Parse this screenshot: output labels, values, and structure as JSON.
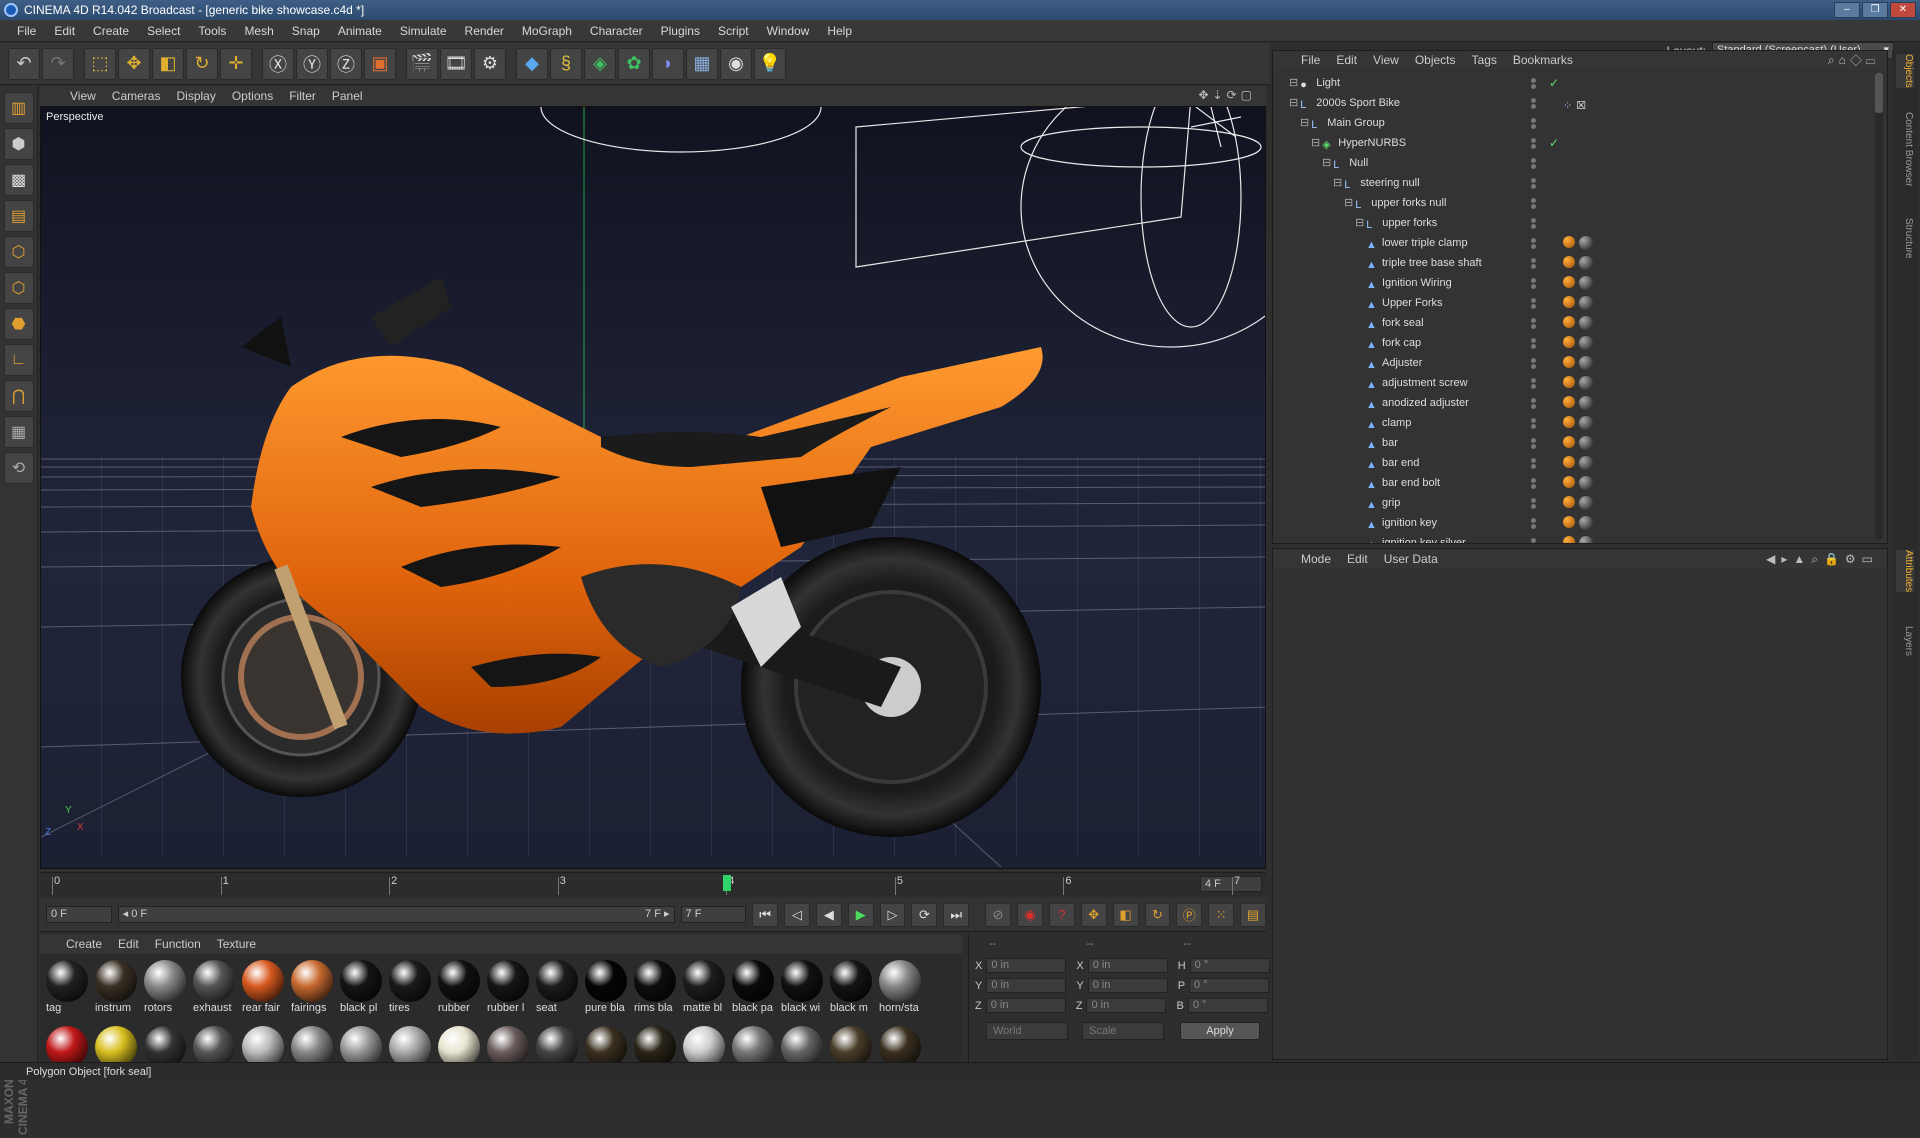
{
  "window": {
    "title": "CINEMA 4D R14.042 Broadcast - [generic bike showcase.c4d *]"
  },
  "menubar": [
    "File",
    "Edit",
    "Create",
    "Select",
    "Tools",
    "Mesh",
    "Snap",
    "Animate",
    "Simulate",
    "Render",
    "MoGraph",
    "Character",
    "Plugins",
    "Script",
    "Window",
    "Help"
  ],
  "layout": {
    "label": "Layout:",
    "value": "Standard (Screencast) (User)"
  },
  "viewport": {
    "menu": [
      "View",
      "Cameras",
      "Display",
      "Options",
      "Filter",
      "Panel"
    ],
    "label": "Perspective",
    "axis_y": "Y",
    "axis_x": "X",
    "axis_z": "Z"
  },
  "timeline": {
    "ticks": [
      "0",
      "1",
      "2",
      "3",
      "4",
      "5",
      "6",
      "7"
    ],
    "current_frame": 4,
    "frame_field": "4 F"
  },
  "transport": {
    "start": "0 F",
    "range_start": "◂ 0 F",
    "range_end": "7 F ▸",
    "end": "7 F"
  },
  "material_menu": [
    "Create",
    "Edit",
    "Function",
    "Texture"
  ],
  "materials_row1": [
    {
      "label": "tag",
      "color": "#222"
    },
    {
      "label": "instrum",
      "color": "#3a3024"
    },
    {
      "label": "rotors",
      "color": "#8a8a8a"
    },
    {
      "label": "exhaust",
      "color": "#555"
    },
    {
      "label": "rear fair",
      "color": "#d85a20"
    },
    {
      "label": "fairings",
      "color": "#c86a30"
    },
    {
      "label": "black pl",
      "color": "#151515"
    },
    {
      "label": "tires",
      "color": "#1a1a1a"
    },
    {
      "label": "rubber",
      "color": "#111"
    },
    {
      "label": "rubber l",
      "color": "#161616"
    },
    {
      "label": "seat",
      "color": "#1c1c1c"
    },
    {
      "label": "pure bla",
      "color": "#050505"
    },
    {
      "label": "rims bla",
      "color": "#0d0d0d"
    },
    {
      "label": "matte bl",
      "color": "#1e1e1e"
    },
    {
      "label": "black pa",
      "color": "#0a0a0a"
    },
    {
      "label": "black wi",
      "color": "#111"
    },
    {
      "label": "black m",
      "color": "#141414"
    },
    {
      "label": "horn/sta",
      "color": "#888"
    }
  ],
  "materials_row2": [
    "#c01818",
    "#d8c020",
    "#333",
    "#555",
    "#bbb",
    "#888",
    "#999",
    "#aaa",
    "#e8e4d0",
    "#6a5c5c",
    "#444",
    "#3a3020",
    "#2a2418",
    "#ccc",
    "#777",
    "#666",
    "#4a3e2a",
    "#3a3020"
  ],
  "coords": {
    "headers": [
      "--",
      "--",
      "--"
    ],
    "rows": [
      {
        "a": "X",
        "av": "0 in",
        "b": "X",
        "bv": "0 in",
        "c": "H",
        "cv": "0 °"
      },
      {
        "a": "Y",
        "av": "0 in",
        "b": "Y",
        "bv": "0 in",
        "c": "P",
        "cv": "0 °"
      },
      {
        "a": "Z",
        "av": "0 in",
        "b": "Z",
        "bv": "0 in",
        "c": "B",
        "cv": "0 °"
      }
    ],
    "world": "World",
    "scale": "Scale",
    "apply": "Apply"
  },
  "object_menu": [
    "File",
    "Edit",
    "View",
    "Objects",
    "Tags",
    "Bookmarks"
  ],
  "objects": [
    {
      "name": "Light",
      "indent": 0,
      "icon": "light-icon",
      "check": true,
      "tags": 0
    },
    {
      "name": "2000s Sport Bike",
      "indent": 0,
      "icon": "null-icon",
      "check": false,
      "tags": -1
    },
    {
      "name": "Main Group",
      "indent": 1,
      "icon": "null-icon",
      "check": false,
      "tags": 0
    },
    {
      "name": "HyperNURBS",
      "indent": 2,
      "icon": "hypernurbs-icon",
      "check": true,
      "tags": 0
    },
    {
      "name": "Null",
      "indent": 3,
      "icon": "null-icon",
      "check": false,
      "tags": 0
    },
    {
      "name": "steering null",
      "indent": 4,
      "icon": "null-icon",
      "check": false,
      "tags": 0
    },
    {
      "name": "upper forks null",
      "indent": 5,
      "icon": "null-icon",
      "check": false,
      "tags": 0
    },
    {
      "name": "upper forks",
      "indent": 6,
      "icon": "null-icon",
      "check": false,
      "tags": 0
    },
    {
      "name": "lower triple clamp",
      "indent": 7,
      "icon": "polygon-icon",
      "check": false,
      "tags": 2
    },
    {
      "name": "triple tree base shaft",
      "indent": 7,
      "icon": "polygon-icon",
      "check": false,
      "tags": 2
    },
    {
      "name": "Ignition Wiring",
      "indent": 7,
      "icon": "polygon-icon",
      "check": false,
      "tags": 2
    },
    {
      "name": "Upper Forks",
      "indent": 7,
      "icon": "polygon-icon",
      "check": false,
      "tags": 2
    },
    {
      "name": "fork seal",
      "indent": 7,
      "icon": "polygon-icon",
      "check": false,
      "tags": 2
    },
    {
      "name": "fork cap",
      "indent": 7,
      "icon": "polygon-icon",
      "check": false,
      "tags": 2
    },
    {
      "name": "Adjuster",
      "indent": 7,
      "icon": "polygon-icon",
      "check": false,
      "tags": 2
    },
    {
      "name": "adjustment screw",
      "indent": 7,
      "icon": "polygon-icon",
      "check": false,
      "tags": 2
    },
    {
      "name": "anodized adjuster",
      "indent": 7,
      "icon": "polygon-icon",
      "check": false,
      "tags": 2
    },
    {
      "name": "clamp",
      "indent": 7,
      "icon": "polygon-icon",
      "check": false,
      "tags": 2
    },
    {
      "name": "bar",
      "indent": 7,
      "icon": "polygon-icon",
      "check": false,
      "tags": 2
    },
    {
      "name": "bar end",
      "indent": 7,
      "icon": "polygon-icon",
      "check": false,
      "tags": 2
    },
    {
      "name": "bar end bolt",
      "indent": 7,
      "icon": "polygon-icon",
      "check": false,
      "tags": 2
    },
    {
      "name": "grip",
      "indent": 7,
      "icon": "polygon-icon",
      "check": false,
      "tags": 2
    },
    {
      "name": "ignition key",
      "indent": 7,
      "icon": "polygon-icon",
      "check": false,
      "tags": 2
    },
    {
      "name": "ignition key silver",
      "indent": 7,
      "icon": "polygon-icon",
      "check": false,
      "tags": 2
    }
  ],
  "attr_menu": [
    "Mode",
    "Edit",
    "User Data"
  ],
  "sidetabs_top": [
    "Objects",
    "Content Browser",
    "Structure"
  ],
  "sidetabs_bottom": [
    "Attributes",
    "Layers"
  ],
  "status": "Polygon Object [fork seal]"
}
